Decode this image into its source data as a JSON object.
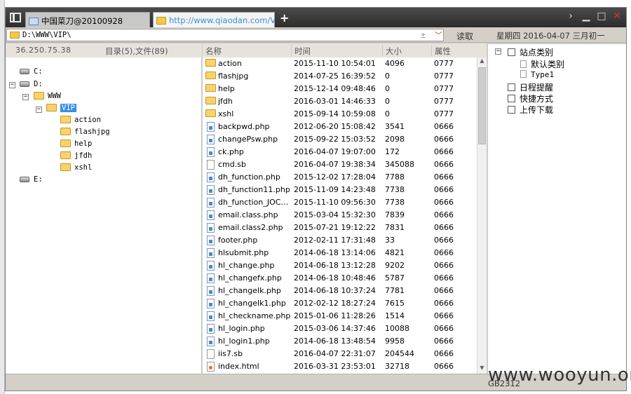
{
  "tabs": [
    {
      "label": "中国菜刀@20100928"
    },
    {
      "label": "http://www.qiaodan.com/VIP..."
    }
  ],
  "new_tab_label": "+",
  "address": {
    "path": "D:\\WWW\\VIP\\",
    "plus_glyph": "±",
    "dropdown_glyph": "﹀",
    "read_label": "读取",
    "date": "星期四 2016-04-07 三月初一"
  },
  "info": {
    "ip": "36.250.75.38",
    "dir_info": "目录(5),文件(89)"
  },
  "tree": {
    "drives": [
      {
        "label": "C:"
      },
      {
        "label": "D:"
      },
      {
        "label": "E:"
      }
    ],
    "www": "WWW",
    "vip": "VIP",
    "children": [
      "action",
      "flashjpg",
      "help",
      "jfdh",
      "xshl"
    ]
  },
  "columns": {
    "name": "名称",
    "time": "时间",
    "size": "大小",
    "attr": "属性"
  },
  "files": [
    {
      "type": "folder",
      "name": "action",
      "time": "2015-11-10 10:54:01",
      "size": "4096",
      "attr": "0777"
    },
    {
      "type": "folder",
      "name": "flashjpg",
      "time": "2014-07-25 16:39:52",
      "size": "0",
      "attr": "0777"
    },
    {
      "type": "folder",
      "name": "help",
      "time": "2015-12-14 09:48:46",
      "size": "0",
      "attr": "0777"
    },
    {
      "type": "folder",
      "name": "jfdh",
      "time": "2016-03-01 14:46:33",
      "size": "0",
      "attr": "0777"
    },
    {
      "type": "folder",
      "name": "xshl",
      "time": "2015-09-14 10:59:08",
      "size": "0",
      "attr": "0777"
    },
    {
      "type": "php",
      "name": "backpwd.php",
      "time": "2012-06-20 15:08:42",
      "size": "3541",
      "attr": "0666"
    },
    {
      "type": "php",
      "name": "changePsw.php",
      "time": "2015-09-22 15:03:52",
      "size": "2098",
      "attr": "0666"
    },
    {
      "type": "php",
      "name": "ck.php",
      "time": "2016-04-07 19:07:00",
      "size": "172",
      "attr": "0666"
    },
    {
      "type": "file",
      "name": "cmd.sb",
      "time": "2016-04-07 19:38:34",
      "size": "345088",
      "attr": "0666"
    },
    {
      "type": "php",
      "name": "dh_function.php",
      "time": "2015-12-02 17:28:04",
      "size": "7788",
      "attr": "0666"
    },
    {
      "type": "php",
      "name": "dh_function11.php",
      "time": "2015-11-09 14:23:48",
      "size": "7738",
      "attr": "0666"
    },
    {
      "type": "php",
      "name": "dh_function_JOCH....",
      "time": "2015-11-10 09:56:30",
      "size": "7738",
      "attr": "0666"
    },
    {
      "type": "php",
      "name": "email.class.php",
      "time": "2015-03-04 15:32:30",
      "size": "7839",
      "attr": "0666"
    },
    {
      "type": "php",
      "name": "email.class2.php",
      "time": "2015-07-21 19:12:22",
      "size": "7831",
      "attr": "0666"
    },
    {
      "type": "php",
      "name": "footer.php",
      "time": "2012-02-11 17:31:48",
      "size": "33",
      "attr": "0666"
    },
    {
      "type": "php",
      "name": "hlsubmit.php",
      "time": "2014-06-18 13:14:06",
      "size": "4821",
      "attr": "0666"
    },
    {
      "type": "php",
      "name": "hl_change.php",
      "time": "2014-06-18 13:12:28",
      "size": "9202",
      "attr": "0666"
    },
    {
      "type": "php",
      "name": "hl_changefx.php",
      "time": "2014-06-18 10:48:46",
      "size": "5787",
      "attr": "0666"
    },
    {
      "type": "php",
      "name": "hl_changelk.php",
      "time": "2014-06-18 10:37:24",
      "size": "7781",
      "attr": "0666"
    },
    {
      "type": "php",
      "name": "hl_changelk1.php",
      "time": "2012-02-12 18:27:24",
      "size": "7615",
      "attr": "0666"
    },
    {
      "type": "php",
      "name": "hl_checkname.php",
      "time": "2015-01-06 11:28:26",
      "size": "1514",
      "attr": "0666"
    },
    {
      "type": "php",
      "name": "hl_login.php",
      "time": "2015-03-06 14:37:46",
      "size": "10088",
      "attr": "0666"
    },
    {
      "type": "php",
      "name": "hl_login1.php",
      "time": "2014-06-18 13:48:54",
      "size": "9958",
      "attr": "0666"
    },
    {
      "type": "file",
      "name": "iis7.sb",
      "time": "2016-04-07 22:31:07",
      "size": "204544",
      "attr": "0666"
    },
    {
      "type": "html",
      "name": "index.html",
      "time": "2016-03-31 23:53:01",
      "size": "32718",
      "attr": "0666"
    }
  ],
  "rpanel": {
    "site_category": "站点类别",
    "default_category": "默认类别",
    "type1": "Type1",
    "schedule": "日程提醒",
    "shortcut": "快捷方式",
    "upload_download": "上传下载"
  },
  "status": {
    "encoding": "GB2312"
  },
  "watermark": "www.wooyun.org",
  "colors": {
    "selection": "#3a8fe0",
    "tab_url": "#3a8fd0",
    "close": "#e03030"
  }
}
